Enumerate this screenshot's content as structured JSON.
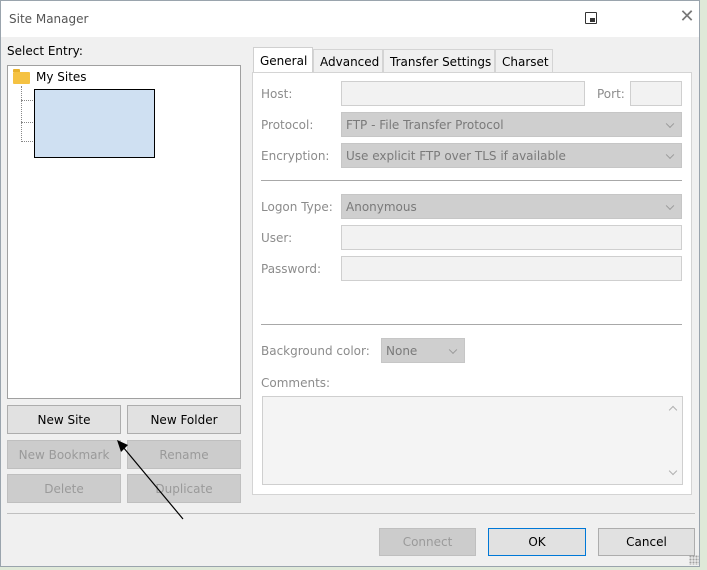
{
  "window": {
    "title": "Site Manager"
  },
  "left": {
    "select_entry_label": "Select Entry:",
    "tree_root": "My Sites",
    "buttons": {
      "new_site": "New Site",
      "new_folder": "New Folder",
      "new_bookmark": "New Bookmark",
      "rename": "Rename",
      "delete": "Delete",
      "duplicate": "Duplicate"
    }
  },
  "tabs": [
    "General",
    "Advanced",
    "Transfer Settings",
    "Charset"
  ],
  "general": {
    "host_label": "Host:",
    "host_value": "",
    "port_label": "Port:",
    "port_value": "",
    "protocol_label": "Protocol:",
    "protocol_value": "FTP - File Transfer Protocol",
    "encryption_label": "Encryption:",
    "encryption_value": "Use explicit FTP over TLS if available",
    "logon_type_label": "Logon Type:",
    "logon_type_value": "Anonymous",
    "user_label": "User:",
    "user_value": "",
    "password_label": "Password:",
    "password_value": "",
    "background_color_label": "Background color:",
    "background_color_value": "None",
    "comments_label": "Comments:",
    "comments_value": ""
  },
  "footer": {
    "connect": "Connect",
    "ok": "OK",
    "cancel": "Cancel"
  },
  "colors": {
    "accent": "#0078d7",
    "folder": "#f5c242",
    "highlight": "#cfe0f2"
  }
}
